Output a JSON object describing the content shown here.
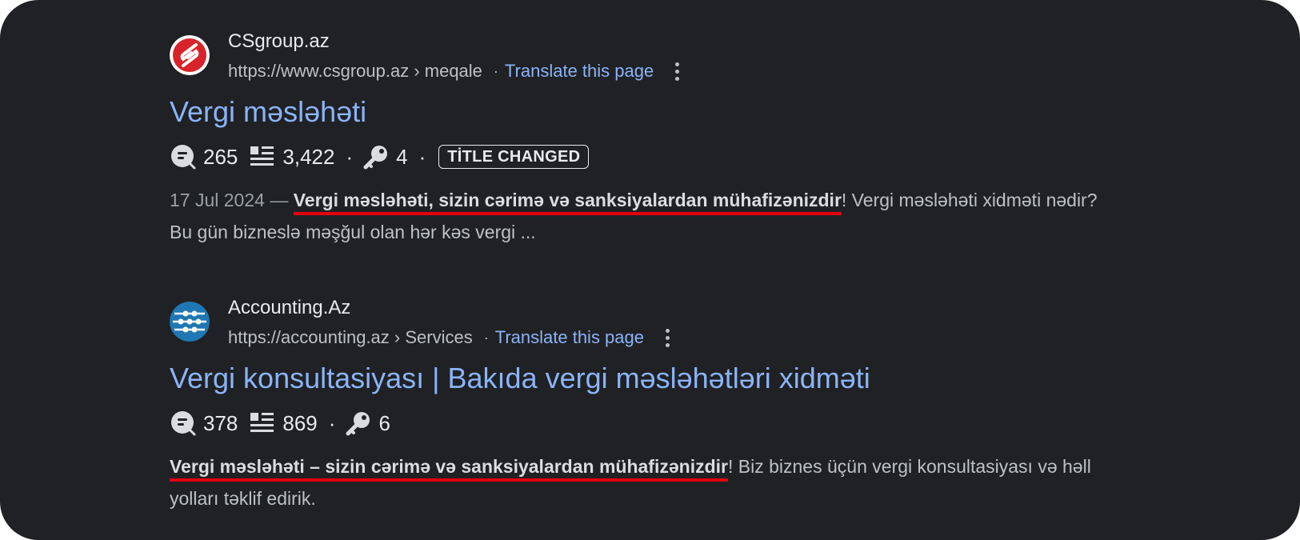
{
  "results": [
    {
      "favicon": "csgroup-logo",
      "site_name": "CSgroup.az",
      "url": "https://www.csgroup.az › meqale",
      "separator": "·",
      "translate": "Translate this page",
      "title": "Vergi məsləhəti",
      "stats": {
        "comments": "265",
        "words": "3,422",
        "keywords": "4"
      },
      "badge": "TİTLE CHANGED",
      "date": "17 Jul 2024 —",
      "highlight": "Vergi məsləhəti, sizin cərimə və sanksiyalardan mühafizənizdir",
      "snippet_rest": "! Vergi məsləhəti xidməti nədir? Bu gün bizneslə məşğul olan hər kəs vergi ..."
    },
    {
      "favicon": "accounting-logo",
      "site_name": "Accounting.Az",
      "url": "https://accounting.az › Services",
      "separator": "·",
      "translate": "Translate this page",
      "title": "Vergi konsultasiyası | Bakıda vergi məsləhətləri xidməti",
      "stats": {
        "comments": "378",
        "words": "869",
        "keywords": "6"
      },
      "highlight": "Vergi məsləhəti – sizin cərimə və sanksiyalardan mühafizənizdir",
      "snippet_rest": "! Biz biznes üçün vergi konsultasiyası və həll yolları təklif edirik."
    }
  ],
  "colors": {
    "background": "#202124",
    "link": "#8ab4f8",
    "text": "#bdc1c6",
    "underline": "#e3000f"
  }
}
